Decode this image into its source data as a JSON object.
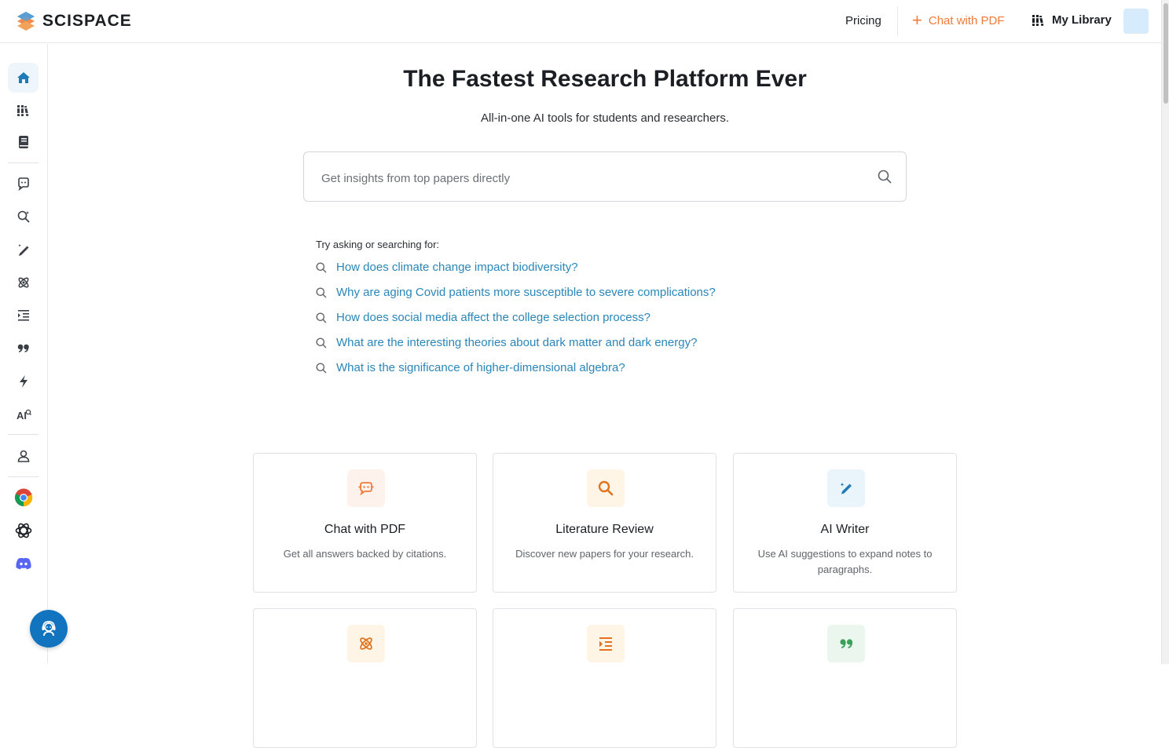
{
  "header": {
    "logo_text": "SCISPACE",
    "nav": {
      "pricing": "Pricing",
      "chat_with_pdf": "Chat with PDF",
      "my_library": "My Library"
    }
  },
  "sidebar": {
    "items": [
      {
        "icon": "home-icon",
        "active": true
      },
      {
        "icon": "library-icon"
      },
      {
        "icon": "notebook-icon"
      },
      {
        "icon": "chat-pdf-icon"
      },
      {
        "icon": "literature-review-icon"
      },
      {
        "icon": "ai-writer-icon"
      },
      {
        "icon": "extract-data-icon"
      },
      {
        "icon": "paraphraser-icon"
      },
      {
        "icon": "citation-icon"
      },
      {
        "icon": "ai-detector-icon"
      },
      {
        "icon": "ai-text-icon"
      },
      {
        "icon": "profile-icon"
      },
      {
        "icon": "chrome-icon"
      },
      {
        "icon": "openai-icon"
      },
      {
        "icon": "discord-icon"
      }
    ]
  },
  "hero": {
    "title": "The Fastest Research Platform Ever",
    "subtitle": "All-in-one AI tools for students and researchers."
  },
  "search": {
    "placeholder": "Get insights from top papers directly",
    "value": ""
  },
  "suggestions": {
    "label": "Try asking or searching for:",
    "items": [
      "How does climate change impact biodiversity?",
      "Why are aging Covid patients more susceptible to severe complications?",
      "How does social media affect the college selection process?",
      "What are the interesting theories about dark matter and dark energy?",
      "What is the significance of higher-dimensional algebra?"
    ]
  },
  "cards": [
    {
      "title": "Chat with PDF",
      "desc": "Get all answers backed by citations.",
      "icon": "chat-pdf-icon",
      "color": "#f07b3a",
      "bg": "#fef3ec"
    },
    {
      "title": "Literature Review",
      "desc": "Discover new papers for your research.",
      "icon": "magnifier-icon",
      "color": "#e0741f",
      "bg": "#fef5e6"
    },
    {
      "title": "AI Writer",
      "desc": "Use AI suggestions to expand notes to paragraphs.",
      "icon": "pen-icon",
      "color": "#1f7ab8",
      "bg": "#eaf4fb"
    },
    {
      "title": "",
      "desc": "",
      "icon": "atom-icon",
      "color": "#e0741f",
      "bg": "#fef5e6"
    },
    {
      "title": "",
      "desc": "",
      "icon": "indent-list-icon",
      "color": "#e0741f",
      "bg": "#fef5e6"
    },
    {
      "title": "",
      "desc": "",
      "icon": "quote-icon",
      "color": "#3aa05a",
      "bg": "#eaf6ee"
    }
  ],
  "colors": {
    "accent_orange": "#f07b3a",
    "link_blue": "#2a86b8",
    "primary_blue": "#1273be"
  }
}
